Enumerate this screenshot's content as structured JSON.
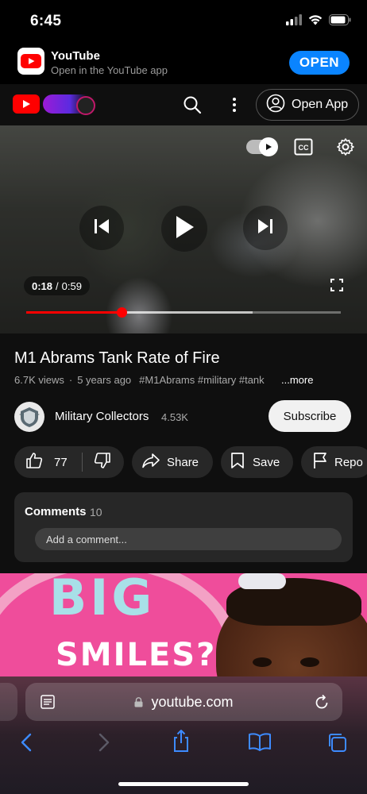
{
  "status_bar": {
    "time": "6:45"
  },
  "app_banner": {
    "title": "YouTube",
    "subtitle": "Open in the YouTube app",
    "open_label": "OPEN"
  },
  "yt_header": {
    "open_app_label": "Open App",
    "icons": [
      "youtube-logo",
      "search-icon",
      "more-vert-icon",
      "account-icon"
    ]
  },
  "player": {
    "current_time": "0:18",
    "separator": "/",
    "duration": "0:59",
    "progress_fraction": 0.305,
    "buffered_fraction": 0.72,
    "autoplay_on": true,
    "icons": [
      "autoplay-toggle",
      "captions-icon",
      "settings-icon",
      "previous-icon",
      "play-icon",
      "next-icon",
      "fullscreen-icon"
    ]
  },
  "video": {
    "title": "M1 Abrams Tank Rate of Fire",
    "views": "6.7K views",
    "age": "5 years ago",
    "hashtags": "#M1Abrams #military #tank",
    "more_label": "...more"
  },
  "channel": {
    "name": "Military Collectors",
    "subscribers": "4.53K",
    "subscribe_label": "Subscribe"
  },
  "actions": {
    "like_count": "77",
    "share_label": "Share",
    "save_label": "Save",
    "report_label": "Repo"
  },
  "comments": {
    "title": "Comments",
    "count": "10",
    "placeholder": "Add a comment..."
  },
  "ad": {
    "headline": "BIG",
    "subline": "SMILES?"
  },
  "safari": {
    "url": "youtube.com"
  },
  "colors": {
    "youtube_red": "#ff0000",
    "ios_blue": "#0a84ff",
    "yt_background": "#0f0f0f",
    "pill_background": "#272727",
    "ad_pink": "#ef4d9b"
  }
}
